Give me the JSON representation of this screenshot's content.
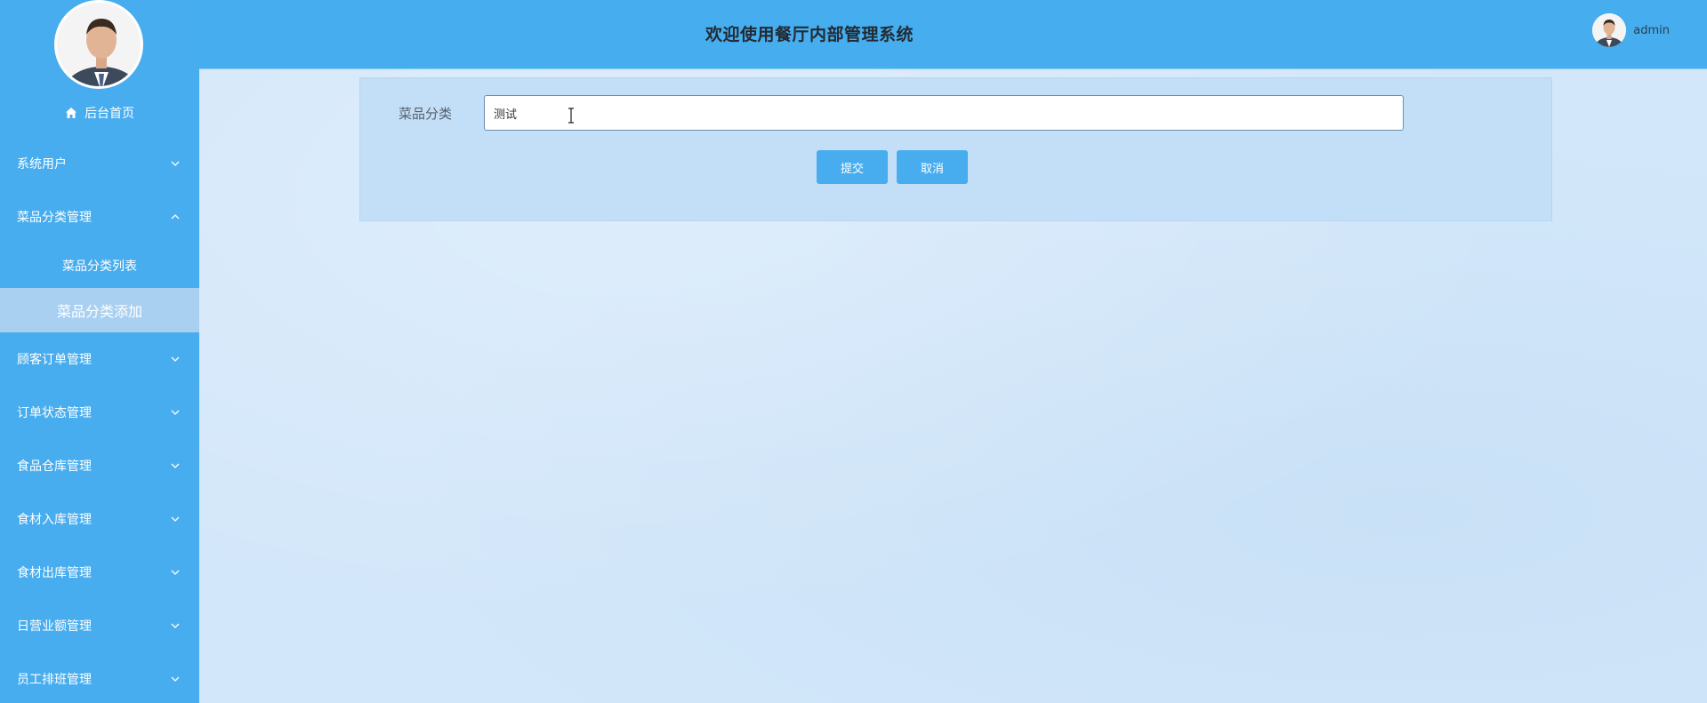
{
  "header": {
    "title": "欢迎使用餐厅内部管理系统",
    "username": "admin"
  },
  "sidebar": {
    "home_label": "后台首页",
    "items": [
      {
        "label": "系统用户",
        "expanded": false
      },
      {
        "label": "菜品分类管理",
        "expanded": true,
        "children": [
          {
            "label": "菜品分类列表",
            "active": false
          },
          {
            "label": "菜品分类添加",
            "active": true
          }
        ]
      },
      {
        "label": "顾客订单管理",
        "expanded": false
      },
      {
        "label": "订单状态管理",
        "expanded": false
      },
      {
        "label": "食品仓库管理",
        "expanded": false
      },
      {
        "label": "食材入库管理",
        "expanded": false
      },
      {
        "label": "食材出库管理",
        "expanded": false
      },
      {
        "label": "日营业额管理",
        "expanded": false
      },
      {
        "label": "员工排班管理",
        "expanded": false
      }
    ]
  },
  "form": {
    "field_label": "菜品分类",
    "field_value": "测试",
    "submit_label": "提交",
    "cancel_label": "取消"
  },
  "colors": {
    "accent": "#47adef",
    "sidebar_bg": "#48adee",
    "active_item_bg": "#a9d0f1",
    "page_bg": "#d4e8fb"
  }
}
